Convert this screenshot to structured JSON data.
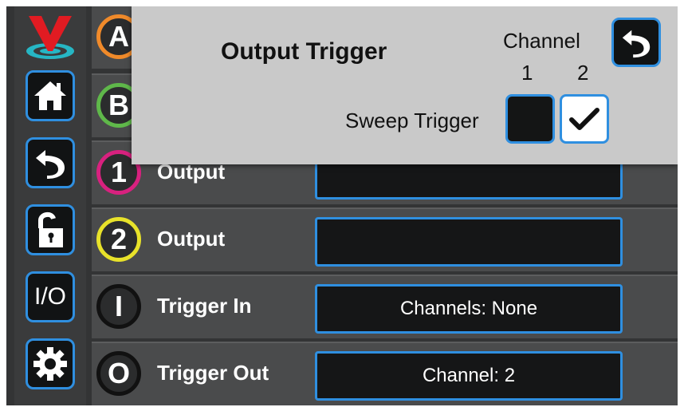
{
  "sidebar": {
    "logo_icon": "v-logo-icon",
    "items": [
      {
        "icon": "home-icon"
      },
      {
        "icon": "back-arrow-icon"
      },
      {
        "icon": "unlock-icon"
      },
      {
        "label": "I/O"
      },
      {
        "icon": "gear-icon"
      }
    ]
  },
  "rows": [
    {
      "badge": "A",
      "badge_color": "#f08a2a",
      "label": "",
      "value": ""
    },
    {
      "badge": "B",
      "badge_color": "#5fb84a",
      "label": "",
      "value": ""
    },
    {
      "badge": "1",
      "badge_color": "#d8217f",
      "label": "Output",
      "value": ""
    },
    {
      "badge": "2",
      "badge_color": "#e8e22a",
      "label": "Output",
      "value": ""
    },
    {
      "badge": "I",
      "badge_color": "#111111",
      "label": "Trigger In",
      "value": "Channels: None"
    },
    {
      "badge": "O",
      "badge_color": "#111111",
      "label": "Trigger Out",
      "value": "Channel: 2"
    }
  ],
  "popup": {
    "title": "Output Trigger",
    "channel_header": "Channel",
    "channel_numbers": [
      "1",
      "2"
    ],
    "sweep_label": "Sweep Trigger",
    "channel_1_checked": false,
    "channel_2_checked": true,
    "back_icon": "back-arrow-icon"
  },
  "colors": {
    "accent_blue": "#2f8fe0",
    "popup_bg": "#c9c9c9",
    "screen_bg": "#333435"
  }
}
